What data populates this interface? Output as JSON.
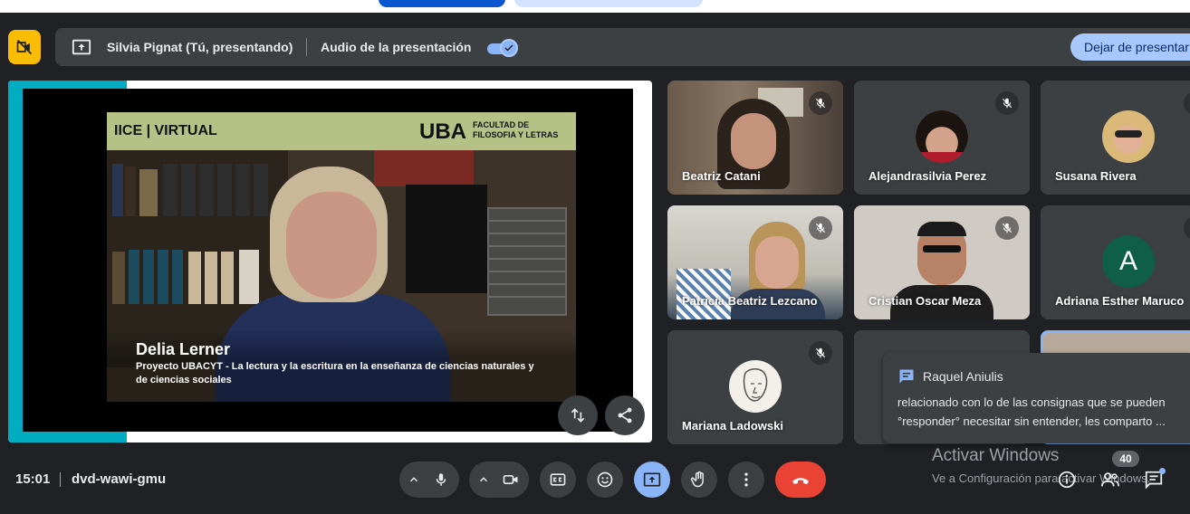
{
  "presentation_bar": {
    "presenter": "Silvia Pignat (Tú, presentando)",
    "audio_label": "Audio de la presentación",
    "audio_enabled": true,
    "stop_button": "Dejar de presentar"
  },
  "slide": {
    "header_left": "IICE | VIRTUAL",
    "header_uba": "UBA",
    "header_faculty": "FACULTAD DE FILOSOFIA Y LETRAS",
    "speaker_name": "Delia Lerner",
    "speaker_subtitle": "Proyecto UBACYT - La lectura y la escritura en la enseñanza de ciencias naturales y de ciencias sociales"
  },
  "participants": [
    {
      "name": "Beatriz Catani",
      "muted": true
    },
    {
      "name": "Alejandrasilvia Perez",
      "muted": true
    },
    {
      "name": "Susana Rivera",
      "muted": true
    },
    {
      "name": "Patricia Beatriz Lezcano",
      "muted": true
    },
    {
      "name": "Cristian Oscar Meza",
      "muted": true
    },
    {
      "name": "Adriana Esther Maruco",
      "muted": true,
      "initial": "A"
    },
    {
      "name": "Mariana Ladowski",
      "muted": true
    }
  ],
  "chat_toast": {
    "sender": "Raquel Aniulis",
    "line1": "relacionado con lo de las consignas que se pueden",
    "line2": "°responder° necesitar sin entender, les comparto ..."
  },
  "windows_watermark": {
    "title": "Activar Windows",
    "subtitle": "Ve a Configuración para activar Windows."
  },
  "bottom_bar": {
    "time": "15:01",
    "meeting_code": "dvd-wawi-gmu",
    "participant_count": "40"
  },
  "colors": {
    "background": "#202124",
    "tile": "#3c4043",
    "accent": "#8ab4f8",
    "end_call": "#ea4335",
    "camera_off": "#fbbc04"
  }
}
